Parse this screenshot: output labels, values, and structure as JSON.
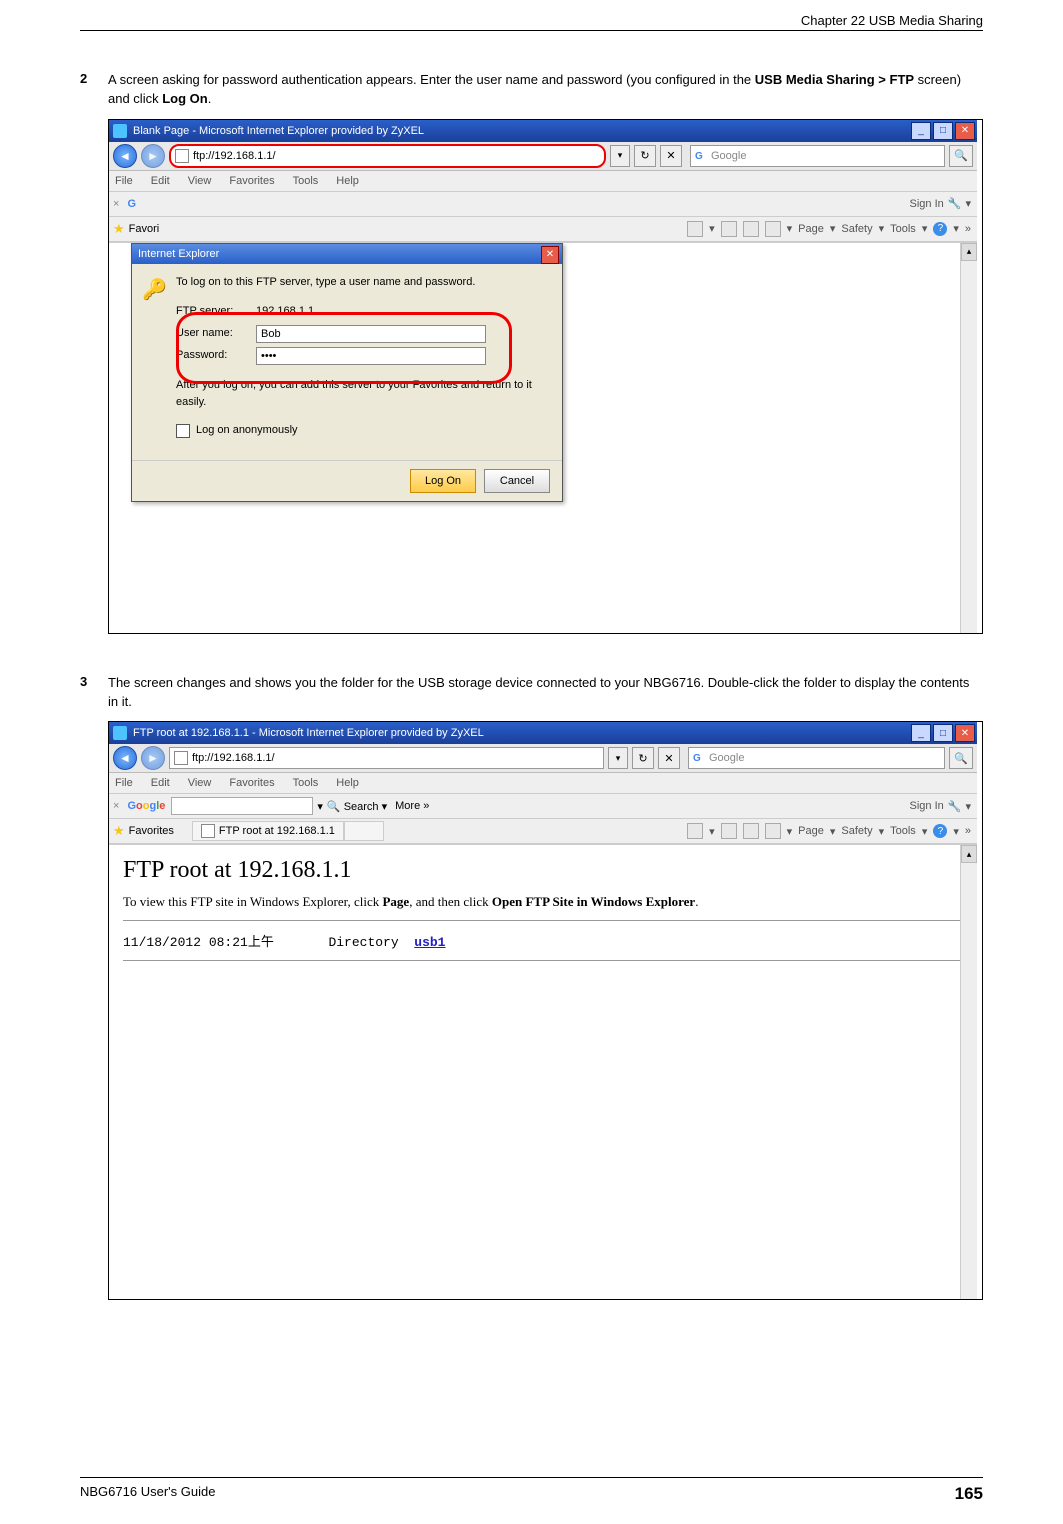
{
  "header": {
    "chapter": "Chapter 22 USB Media Sharing"
  },
  "step2": {
    "number": "2",
    "text_pre": "A screen asking for password authentication appears. Enter the user name and password (you configured in the ",
    "bold1": "USB Media Sharing > FTP",
    "text_mid": " screen) and click ",
    "bold2": "Log On",
    "text_end": "."
  },
  "step3": {
    "number": "3",
    "text": "The screen changes and shows you the folder for the USB storage device connected to your NBG6716. Double-click the folder to display the contents in it."
  },
  "ie1": {
    "title": "Blank Page - Microsoft Internet Explorer provided by ZyXEL",
    "address": "ftp://192.168.1.1/",
    "search_placeholder": "Google",
    "menus": [
      "File",
      "Edit",
      "View",
      "Favorites",
      "Tools",
      "Help"
    ],
    "sign_in": "Sign In",
    "favorites": "Favorites",
    "favori_tab": "Favori",
    "tools_right": [
      "Page",
      "Safety",
      "Tools"
    ],
    "dialog": {
      "title": "Internet Explorer",
      "instruction": "To log on to this FTP server, type a user name and password.",
      "fields": {
        "server_label": "FTP server:",
        "server_value": "192.168.1.1",
        "user_label": "User name:",
        "user_value": "Bob",
        "pwd_label": "Password:",
        "pwd_value": "••••"
      },
      "after": "After you log on, you can add this server to your Favorites and return to it easily.",
      "anon": "Log on anonymously",
      "log_on": "Log On",
      "cancel": "Cancel"
    }
  },
  "ie2": {
    "title": "FTP root at 192.168.1.1 - Microsoft Internet Explorer provided by ZyXEL",
    "address": "ftp://192.168.1.1/",
    "search_placeholder": "Google",
    "menus": [
      "File",
      "Edit",
      "View",
      "Favorites",
      "Tools",
      "Help"
    ],
    "google_label": "Google",
    "search_btn": "Search",
    "more_btn": "More »",
    "sign_in": "Sign In",
    "favorites": "Favorites",
    "tab_label": "FTP root at 192.168.1.1",
    "tools_right": [
      "Page",
      "Safety",
      "Tools"
    ],
    "page_title": "FTP root at 192.168.1.1",
    "instr_pre": "To view this FTP site in Windows Explorer, click ",
    "instr_b1": "Page",
    "instr_mid": ", and then click ",
    "instr_b2": "Open FTP Site in Windows Explorer",
    "instr_end": ".",
    "dir_date": "11/18/2012 08:21上午",
    "dir_label": "Directory",
    "dir_name": "usb1"
  },
  "footer": {
    "guide": "NBG6716 User's Guide",
    "page": "165"
  }
}
